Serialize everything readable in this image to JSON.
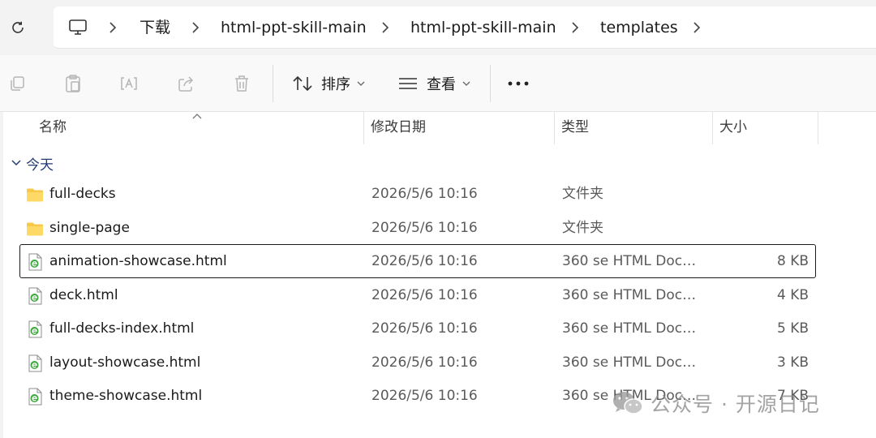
{
  "address_bar": {
    "breadcrumbs": [
      "下载",
      "html-ppt-skill-main",
      "html-ppt-skill-main",
      "templates"
    ]
  },
  "toolbar": {
    "sort_label": "排序",
    "view_label": "查看"
  },
  "columns": {
    "name": "名称",
    "date": "修改日期",
    "type": "类型",
    "size": "大小"
  },
  "group": {
    "label": "今天"
  },
  "files": [
    {
      "name": "full-decks",
      "date": "2026/5/6 10:16",
      "type": "文件夹",
      "size": "",
      "kind": "folder-icon"
    },
    {
      "name": "single-page",
      "date": "2026/5/6 10:16",
      "type": "文件夹",
      "size": "",
      "kind": "folder-icon"
    },
    {
      "name": "animation-showcase.html",
      "date": "2026/5/6 10:16",
      "type": "360 se HTML Docu...",
      "size": "8 KB",
      "kind": "html-file-icon",
      "selected": true
    },
    {
      "name": "deck.html",
      "date": "2026/5/6 10:16",
      "type": "360 se HTML Docu...",
      "size": "4 KB",
      "kind": "html-file-icon"
    },
    {
      "name": "full-decks-index.html",
      "date": "2026/5/6 10:16",
      "type": "360 se HTML Docu...",
      "size": "5 KB",
      "kind": "html-file-icon"
    },
    {
      "name": "layout-showcase.html",
      "date": "2026/5/6 10:16",
      "type": "360 se HTML Docu...",
      "size": "3 KB",
      "kind": "html-file-icon"
    },
    {
      "name": "theme-showcase.html",
      "date": "2026/5/6 10:16",
      "type": "360 se HTML Docu...",
      "size": "7 KB",
      "kind": "html-file-icon"
    }
  ],
  "watermark": {
    "text": "公众号 · 开源日记"
  },
  "colors": {
    "folder": "#f7c948",
    "html_icon_green": "#3aa63a",
    "group_label": "#1f3b72",
    "selection_border": "#1a1a1a"
  }
}
